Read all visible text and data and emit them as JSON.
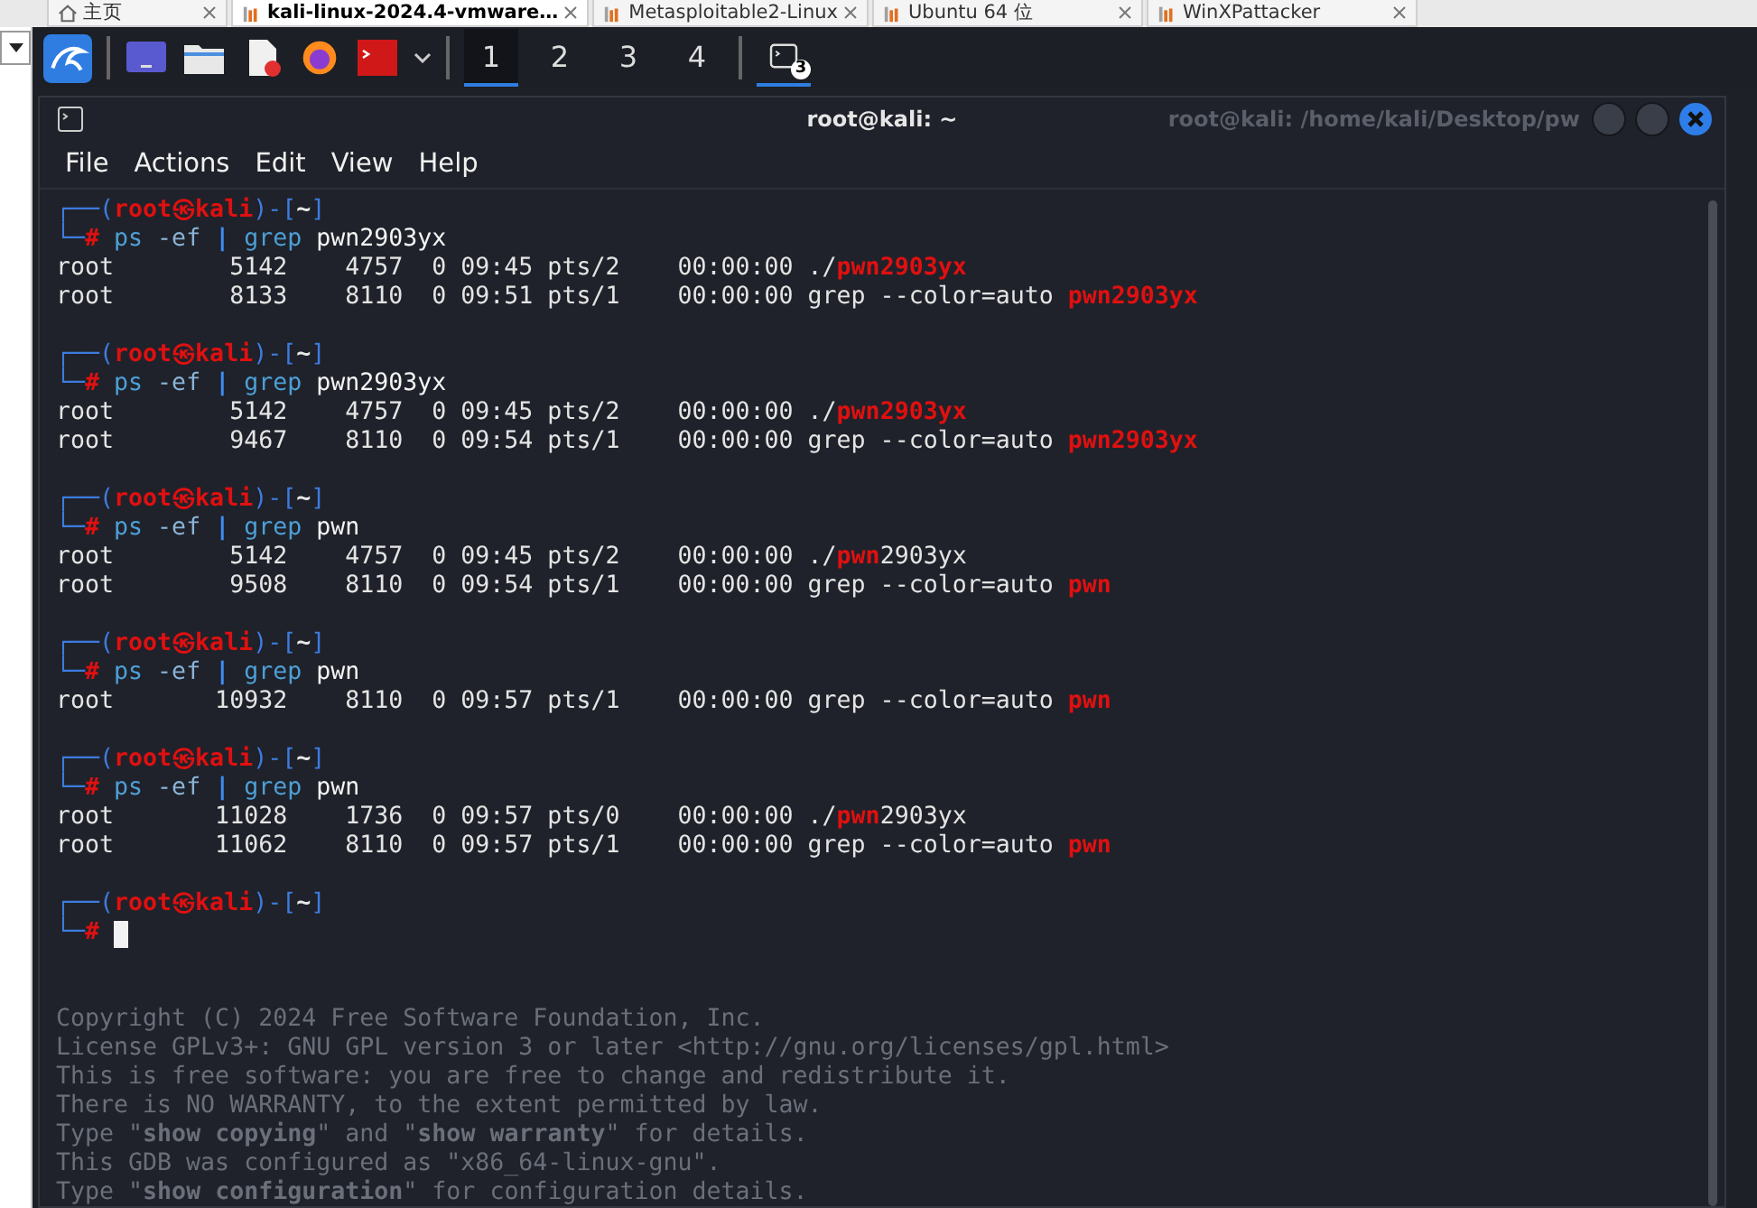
{
  "host_tabs": [
    {
      "label": "主页",
      "kind": "home",
      "selected": false
    },
    {
      "label": "kali-linux-2024.4-vmware…",
      "kind": "vm",
      "selected": true
    },
    {
      "label": "Metasploitable2-Linux",
      "kind": "vm",
      "selected": false
    },
    {
      "label": "Ubuntu 64 位",
      "kind": "vm",
      "selected": false
    },
    {
      "label": "WinXPattacker",
      "kind": "vm",
      "selected": false
    }
  ],
  "taskbar": {
    "workspaces": [
      {
        "label": "1",
        "selected": true
      },
      {
        "label": "2",
        "selected": false
      },
      {
        "label": "3",
        "selected": false
      },
      {
        "label": "4",
        "selected": false
      }
    ],
    "task_badge": "3"
  },
  "window": {
    "title": "root@kali: ~",
    "behind_title": "root@kali: /home/kali/Desktop/pw",
    "menu": [
      "File",
      "Actions",
      "Edit",
      "View",
      "Help"
    ]
  },
  "terminal": {
    "lines": [
      {
        "kind": "prompt",
        "segments": [
          {
            "text": "┌──(",
            "kind": "frame"
          },
          {
            "text": "root㉿kali",
            "kind": "user"
          },
          {
            "text": ")-[",
            "kind": "frame"
          },
          {
            "text": "~",
            "kind": "dir"
          },
          {
            "text": "]",
            "kind": "frame"
          }
        ]
      },
      {
        "kind": "command",
        "cursor": false,
        "segments": [
          {
            "text": "└─",
            "kind": "frame"
          },
          {
            "text": "# ",
            "kind": "hash"
          },
          {
            "text": "ps",
            "kind": "exec"
          },
          {
            "text": " -ef ",
            "kind": "flag"
          },
          {
            "text": "|",
            "kind": "pipe"
          },
          {
            "text": " grep",
            "kind": "exec"
          },
          {
            "text": " pwn2903yx",
            "kind": "text"
          }
        ]
      },
      {
        "kind": "output",
        "segments": [
          {
            "text": "root        5142    4757  0 09:45 pts/2    00:00:00 ./",
            "kind": "text"
          },
          {
            "text": "pwn2903yx",
            "kind": "match"
          }
        ]
      },
      {
        "kind": "output",
        "segments": [
          {
            "text": "root        8133    8110  0 09:51 pts/1    00:00:00 grep --color=auto ",
            "kind": "text"
          },
          {
            "text": "pwn2903yx",
            "kind": "match"
          }
        ]
      },
      {
        "kind": "blank"
      },
      {
        "kind": "prompt",
        "segments": [
          {
            "text": "┌──(",
            "kind": "frame"
          },
          {
            "text": "root㉿kali",
            "kind": "user"
          },
          {
            "text": ")-[",
            "kind": "frame"
          },
          {
            "text": "~",
            "kind": "dir"
          },
          {
            "text": "]",
            "kind": "frame"
          }
        ]
      },
      {
        "kind": "command",
        "cursor": false,
        "segments": [
          {
            "text": "└─",
            "kind": "frame"
          },
          {
            "text": "# ",
            "kind": "hash"
          },
          {
            "text": "ps",
            "kind": "exec"
          },
          {
            "text": " -ef ",
            "kind": "flag"
          },
          {
            "text": "|",
            "kind": "pipe"
          },
          {
            "text": " grep",
            "kind": "exec"
          },
          {
            "text": " pwn2903yx",
            "kind": "text"
          }
        ]
      },
      {
        "kind": "output",
        "segments": [
          {
            "text": "root        5142    4757  0 09:45 pts/2    00:00:00 ./",
            "kind": "text"
          },
          {
            "text": "pwn2903yx",
            "kind": "match"
          }
        ]
      },
      {
        "kind": "output",
        "segments": [
          {
            "text": "root        9467    8110  0 09:54 pts/1    00:00:00 grep --color=auto ",
            "kind": "text"
          },
          {
            "text": "pwn2903yx",
            "kind": "match"
          }
        ]
      },
      {
        "kind": "blank"
      },
      {
        "kind": "prompt",
        "segments": [
          {
            "text": "┌──(",
            "kind": "frame"
          },
          {
            "text": "root㉿kali",
            "kind": "user"
          },
          {
            "text": ")-[",
            "kind": "frame"
          },
          {
            "text": "~",
            "kind": "dir"
          },
          {
            "text": "]",
            "kind": "frame"
          }
        ]
      },
      {
        "kind": "command",
        "cursor": false,
        "segments": [
          {
            "text": "└─",
            "kind": "frame"
          },
          {
            "text": "# ",
            "kind": "hash"
          },
          {
            "text": "ps",
            "kind": "exec"
          },
          {
            "text": " -ef ",
            "kind": "flag"
          },
          {
            "text": "|",
            "kind": "pipe"
          },
          {
            "text": " grep",
            "kind": "exec"
          },
          {
            "text": " pwn",
            "kind": "text"
          }
        ]
      },
      {
        "kind": "output",
        "segments": [
          {
            "text": "root        5142    4757  0 09:45 pts/2    00:00:00 ./",
            "kind": "text"
          },
          {
            "text": "pwn",
            "kind": "match"
          },
          {
            "text": "2903yx",
            "kind": "text"
          }
        ]
      },
      {
        "kind": "output",
        "segments": [
          {
            "text": "root        9508    8110  0 09:54 pts/1    00:00:00 grep --color=auto ",
            "kind": "text"
          },
          {
            "text": "pwn",
            "kind": "match"
          }
        ]
      },
      {
        "kind": "blank"
      },
      {
        "kind": "prompt",
        "segments": [
          {
            "text": "┌──(",
            "kind": "frame"
          },
          {
            "text": "root㉿kali",
            "kind": "user"
          },
          {
            "text": ")-[",
            "kind": "frame"
          },
          {
            "text": "~",
            "kind": "dir"
          },
          {
            "text": "]",
            "kind": "frame"
          }
        ]
      },
      {
        "kind": "command",
        "cursor": false,
        "segments": [
          {
            "text": "└─",
            "kind": "frame"
          },
          {
            "text": "# ",
            "kind": "hash"
          },
          {
            "text": "ps",
            "kind": "exec"
          },
          {
            "text": " -ef ",
            "kind": "flag"
          },
          {
            "text": "|",
            "kind": "pipe"
          },
          {
            "text": " grep",
            "kind": "exec"
          },
          {
            "text": " pwn",
            "kind": "text"
          }
        ]
      },
      {
        "kind": "output",
        "segments": [
          {
            "text": "root       10932    8110  0 09:57 pts/1    00:00:00 grep --color=auto ",
            "kind": "text"
          },
          {
            "text": "pwn",
            "kind": "match"
          }
        ]
      },
      {
        "kind": "blank"
      },
      {
        "kind": "prompt",
        "segments": [
          {
            "text": "┌──(",
            "kind": "frame"
          },
          {
            "text": "root㉿kali",
            "kind": "user"
          },
          {
            "text": ")-[",
            "kind": "frame"
          },
          {
            "text": "~",
            "kind": "dir"
          },
          {
            "text": "]",
            "kind": "frame"
          }
        ]
      },
      {
        "kind": "command",
        "cursor": false,
        "segments": [
          {
            "text": "└─",
            "kind": "frame"
          },
          {
            "text": "# ",
            "kind": "hash"
          },
          {
            "text": "ps",
            "kind": "exec"
          },
          {
            "text": " -ef ",
            "kind": "flag"
          },
          {
            "text": "|",
            "kind": "pipe"
          },
          {
            "text": " grep",
            "kind": "exec"
          },
          {
            "text": " pwn",
            "kind": "text"
          }
        ]
      },
      {
        "kind": "output",
        "segments": [
          {
            "text": "root       11028    1736  0 09:57 pts/0    00:00:00 ./",
            "kind": "text"
          },
          {
            "text": "pwn",
            "kind": "match"
          },
          {
            "text": "2903yx",
            "kind": "text"
          }
        ]
      },
      {
        "kind": "output",
        "segments": [
          {
            "text": "root       11062    8110  0 09:57 pts/1    00:00:00 grep --color=auto ",
            "kind": "text"
          },
          {
            "text": "pwn",
            "kind": "match"
          }
        ]
      },
      {
        "kind": "blank"
      },
      {
        "kind": "prompt",
        "segments": [
          {
            "text": "┌──(",
            "kind": "frame"
          },
          {
            "text": "root㉿kali",
            "kind": "user"
          },
          {
            "text": ")-[",
            "kind": "frame"
          },
          {
            "text": "~",
            "kind": "dir"
          },
          {
            "text": "]",
            "kind": "frame"
          }
        ]
      },
      {
        "kind": "command",
        "cursor": true,
        "segments": [
          {
            "text": "└─",
            "kind": "frame"
          },
          {
            "text": "# ",
            "kind": "hash"
          }
        ]
      },
      {
        "kind": "blank"
      },
      {
        "kind": "blank"
      },
      {
        "kind": "ghost",
        "segments": [
          {
            "text": "Copyright (C) 2024 Free Software Foundation, Inc.",
            "kind": "ghost"
          }
        ]
      },
      {
        "kind": "ghost",
        "segments": [
          {
            "text": "License GPLv3+: GNU GPL version 3 or later <http://gnu.org/licenses/gpl.html>",
            "kind": "ghost"
          }
        ]
      },
      {
        "kind": "ghost",
        "segments": [
          {
            "text": "This is free software: you are free to change and redistribute it.",
            "kind": "ghost"
          }
        ]
      },
      {
        "kind": "ghost",
        "segments": [
          {
            "text": "There is NO WARRANTY, to the extent permitted by law.",
            "kind": "ghost"
          }
        ]
      },
      {
        "kind": "ghost",
        "segments": [
          {
            "text": "Type \"**show copying**\" and \"**show warranty**\" for details.",
            "kind": "ghost"
          }
        ]
      },
      {
        "kind": "ghost",
        "segments": [
          {
            "text": "This GDB was configured as \"x86_64-linux-gnu\".",
            "kind": "ghost"
          }
        ]
      },
      {
        "kind": "ghost",
        "segments": [
          {
            "text": "Type \"**show configuration**\" for configuration details.",
            "kind": "ghost"
          }
        ]
      }
    ]
  }
}
